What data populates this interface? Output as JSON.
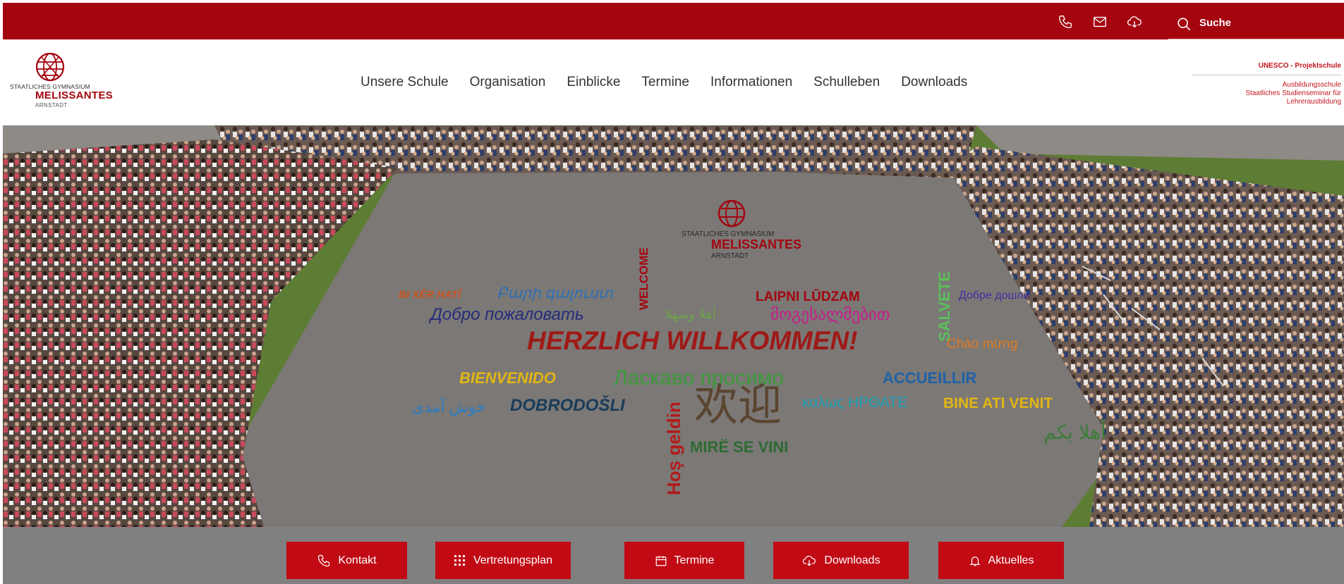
{
  "topbar": {
    "icons": [
      "phone-icon",
      "mail-icon",
      "cloud-download-icon"
    ],
    "search_label": "Suche"
  },
  "logo": {
    "line1": "STAATLICHES GYMNASIUM",
    "line2": "MELISSANTES",
    "line3": "ARNSTADT"
  },
  "nav": {
    "items": [
      "Unsere Schule",
      "Organisation",
      "Einblicke",
      "Termine",
      "Informationen",
      "Schulleben",
      "Downloads"
    ]
  },
  "right_info": {
    "unesco": "UNESCO - Projektschule",
    "ausbildung_line1": "Ausbildungsschule",
    "ausbildung_line2": "Staatliches Studienseminar für Lehrerausbildung"
  },
  "hero": {
    "logo_line1": "STAATLICHES GYMNASIUM",
    "logo_line2": "MELISSANTES",
    "logo_line3": "ARNSTADT",
    "words": {
      "bixer": "BI XÊR HATÎ",
      "armenian": "Բարի գալուստ",
      "welcome": "WELCOME",
      "laipni": "LAIPNI LŪDZAM",
      "salvete": "SALVETE",
      "ukrainian": "Добре дошли",
      "russian": "Добро пожаловать",
      "arabic1": "أهلا وسهلا",
      "georgian": "მოგესალმებით",
      "herzlich": "HERZLICH WILLKOMMEN!",
      "chao": "Chào mừng",
      "bienvenido": "BIENVENIDO",
      "laskavo": "Ласкаво просимо",
      "accueillir": "ACCUEILLIR",
      "persian": "خوش آمدی",
      "dobrodosli": "DOBRODOŠLI",
      "hos": "Hoş geldin",
      "chinese": "欢迎",
      "greek": "καλως ΗΡΘΑΤΕ",
      "bine": "BINE ATI VENIT",
      "arabic2": "أهلا بكم",
      "mire": "MIRË SE VINI"
    }
  },
  "quicklinks": [
    {
      "label": "Kontakt",
      "icon": "phone-icon"
    },
    {
      "label": "Vertretungsplan",
      "icon": "grid-icon"
    },
    {
      "label": "Termine",
      "icon": "calendar-icon"
    },
    {
      "label": "Downloads",
      "icon": "cloud-download-icon"
    },
    {
      "label": "Aktuelles",
      "icon": "bell-icon"
    }
  ],
  "colors": {
    "brand_red": "#a4050f",
    "button_red": "#c10a14",
    "quickbar_gray": "#808080"
  }
}
